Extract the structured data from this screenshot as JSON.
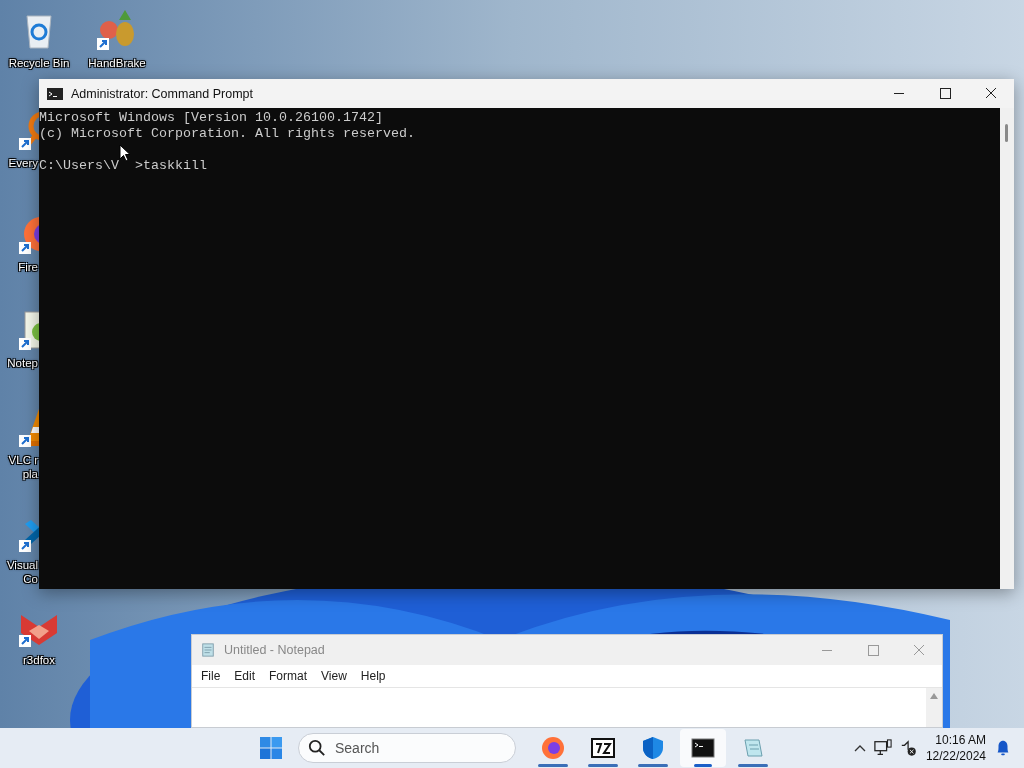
{
  "desktop_icons": [
    {
      "kind": "recycle",
      "lines": [
        "Recycle Bin"
      ],
      "shortcut": false
    },
    {
      "kind": "handbrake",
      "lines": [
        "HandBrake"
      ],
      "shortcut": true
    },
    {
      "kind": "everything",
      "lines": [
        "Every"
      ],
      "shortcut": true
    },
    {
      "kind": "firefox",
      "lines": [
        "Fire"
      ],
      "shortcut": true
    },
    {
      "kind": "notepadpp",
      "lines": [
        "Notep"
      ],
      "shortcut": true
    },
    {
      "kind": "vlc",
      "lines": [
        "VLC r",
        "pla"
      ],
      "shortcut": true
    },
    {
      "kind": "vscode",
      "lines": [
        "Visual",
        "Co"
      ],
      "shortcut": true
    },
    {
      "kind": "r3dfox",
      "lines": [
        "r3dfox"
      ],
      "shortcut": true
    }
  ],
  "command_prompt": {
    "title": "Administrator: Command Prompt",
    "output": [
      "Microsoft Windows [Version 10.0.26100.1742]",
      "(c) Microsoft Corporation. All rights reserved."
    ],
    "prompt_before_cursor": "C:\\Users\\V",
    "prompt_after_cursor": ">taskkill"
  },
  "notepad": {
    "title": "Untitled - Notepad",
    "menu": [
      "File",
      "Edit",
      "Format",
      "View",
      "Help"
    ]
  },
  "taskbar": {
    "search": {
      "placeholder": "Search"
    },
    "apps": [
      {
        "kind": "firefox",
        "selected": false
      },
      {
        "kind": "sevenzip",
        "selected": false
      },
      {
        "kind": "shield",
        "selected": false
      },
      {
        "kind": "terminal",
        "selected": true
      },
      {
        "kind": "notepad",
        "selected": false
      }
    ],
    "time": "10:16 AM",
    "date": "12/22/2024"
  }
}
